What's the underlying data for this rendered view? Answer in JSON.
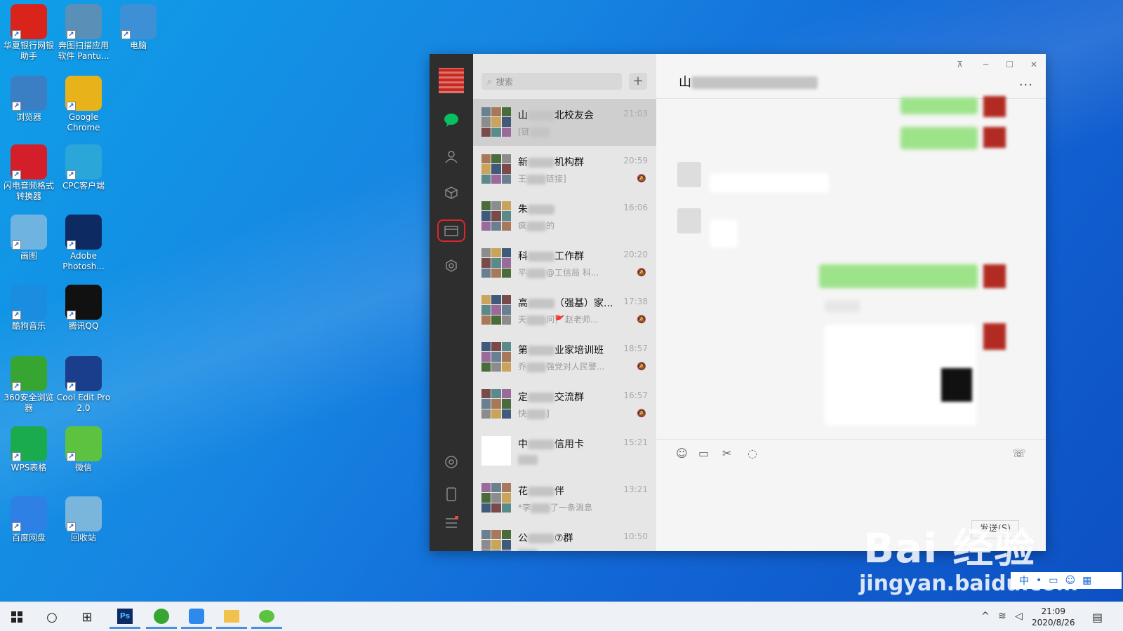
{
  "desktop": {
    "icons": [
      {
        "label": "华夏银行网银助手",
        "icon": "huaxia-bank-icon",
        "color": "#d9241c"
      },
      {
        "label": "奔图扫描应用软件 Pantu...",
        "icon": "scanner-icon",
        "color": "#5a8fb8"
      },
      {
        "label": "电脑",
        "icon": "computer-icon",
        "color": "#3d8fd6"
      },
      {
        "label": "浏览器",
        "icon": "browser-icon",
        "color": "#3a7fc4"
      },
      {
        "label": "Google Chrome",
        "icon": "chrome-icon",
        "color": "#e8b21a"
      },
      {
        "label": "闪电音频格式转换器",
        "icon": "audio-converter-icon",
        "color": "#d41f2a"
      },
      {
        "label": "CPC客户端",
        "icon": "cpc-client-icon",
        "color": "#2aa6d9"
      },
      {
        "label": "画图",
        "icon": "paint-icon",
        "color": "#6fb3e0"
      },
      {
        "label": "Adobe Photosh...",
        "icon": "photoshop-icon",
        "color": "#0d2a63"
      },
      {
        "label": "酷狗音乐",
        "icon": "kugou-icon",
        "color": "#1a8de0"
      },
      {
        "label": "腾讯QQ",
        "icon": "qq-icon",
        "color": "#111111"
      },
      {
        "label": "360安全浏览器",
        "icon": "360-browser-icon",
        "color": "#36a532"
      },
      {
        "label": "Cool Edit Pro 2.0",
        "icon": "cool-edit-icon",
        "color": "#1b3e8c"
      },
      {
        "label": "WPS表格",
        "icon": "wps-sheet-icon",
        "color": "#1aab4e"
      },
      {
        "label": "微信",
        "icon": "wechat-icon",
        "color": "#5cc23f"
      },
      {
        "label": "百度网盘",
        "icon": "baidu-netdisk-icon",
        "color": "#2f80e5"
      },
      {
        "label": "回收站",
        "icon": "recycle-bin-icon",
        "color": "#7ab6dc"
      }
    ]
  },
  "wechat": {
    "search_placeholder": "搜索",
    "add_label": "+",
    "chats": [
      {
        "name_a": "山",
        "name_b": "北校友会",
        "time": "21:03",
        "msg_a": "[链",
        "msg_b": "",
        "muted": false
      },
      {
        "name_a": "新",
        "name_b": "机构群",
        "time": "20:59",
        "msg_a": "王",
        "msg_b": "链接]",
        "muted": true
      },
      {
        "name_a": "朱",
        "name_b": "",
        "time": "16:06",
        "msg_a": "疯",
        "msg_b": "的",
        "muted": false
      },
      {
        "name_a": "科",
        "name_b": "工作群",
        "time": "20:20",
        "msg_a": "平",
        "msg_b": "@工信局 科...",
        "muted": true
      },
      {
        "name_a": "高",
        "name_b": "（强基）家...",
        "time": "17:38",
        "msg_a": "天",
        "msg_b": "问🚩赵老师...",
        "muted": true
      },
      {
        "name_a": "第",
        "name_b": "业家培训班",
        "time": "18:57",
        "msg_a": "乔",
        "msg_b": "强党对人民警...",
        "muted": true
      },
      {
        "name_a": "定",
        "name_b": "交流群",
        "time": "16:57",
        "msg_a": "快",
        "msg_b": "]",
        "muted": true
      },
      {
        "name_a": "中",
        "name_b": "信用卡",
        "time": "15:21",
        "msg_a": "",
        "msg_b": "",
        "muted": false
      },
      {
        "name_a": "花",
        "name_b": "伴",
        "time": "13:21",
        "msg_a": "*李",
        "msg_b": "了一条消息",
        "muted": false
      },
      {
        "name_a": "公",
        "name_b": "⑦群",
        "time": "10:50",
        "msg_a": "",
        "msg_b": "",
        "muted": false
      }
    ],
    "chat_title": "山",
    "more_label": "···",
    "send_label": "发送(S)",
    "pin_label": "⊼",
    "minimize_label": "─",
    "maximize_label": "☐",
    "close_label": "✕"
  },
  "watermark": {
    "big": "Bai 经验",
    "small": "jingyan.baidu.com"
  },
  "ime": {
    "lang": "中"
  },
  "taskbar": {
    "time": "21:09",
    "date": "2020/8/26"
  },
  "colors": {
    "wechat_green": "#07c160",
    "bubble_green": "#9de38a",
    "rail": "#2e2e2e"
  }
}
